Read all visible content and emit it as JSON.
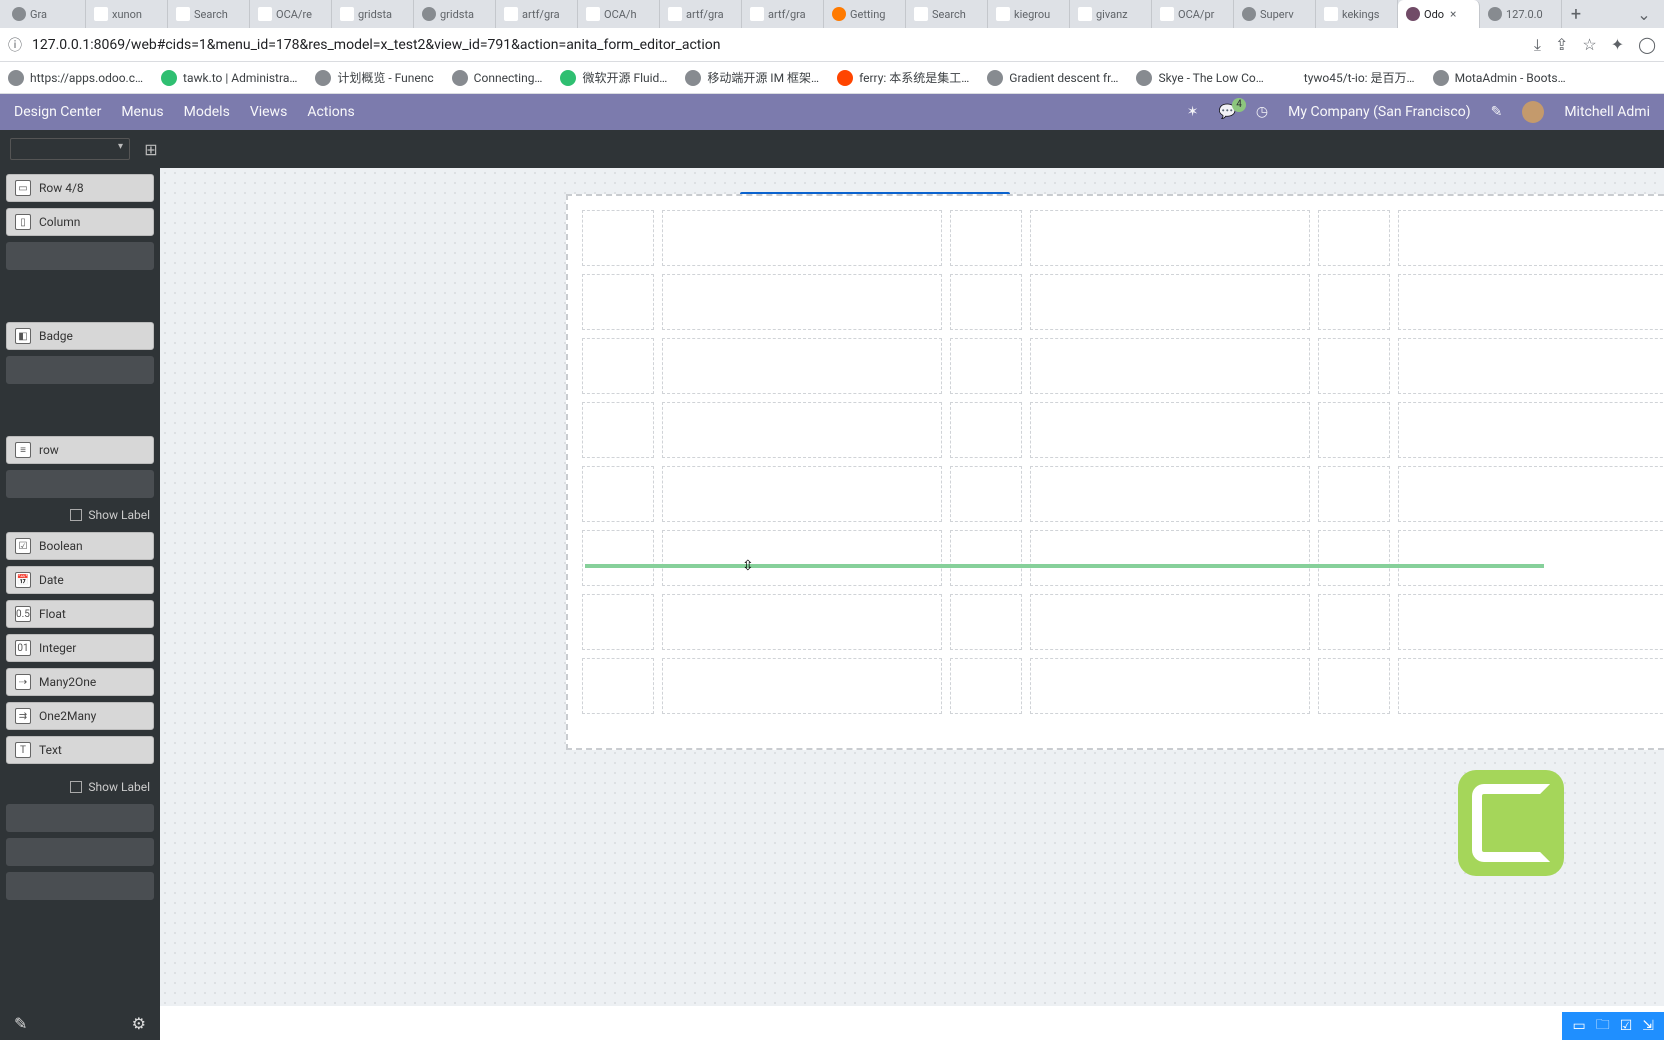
{
  "browser": {
    "tabs": [
      {
        "label": "Gra",
        "fav": "fi-globe"
      },
      {
        "label": "xunon",
        "fav": "fi-github"
      },
      {
        "label": "Search",
        "fav": "fi-github"
      },
      {
        "label": "OCA/re",
        "fav": "fi-github"
      },
      {
        "label": "gridsta",
        "fav": "fi-github"
      },
      {
        "label": "gridsta",
        "fav": "fi-globe"
      },
      {
        "label": "artf/gra",
        "fav": "fi-github"
      },
      {
        "label": "OCA/h",
        "fav": "fi-github"
      },
      {
        "label": "artf/gra",
        "fav": "fi-github"
      },
      {
        "label": "artf/gra",
        "fav": "fi-github"
      },
      {
        "label": "Getting",
        "fav": "fi-orange"
      },
      {
        "label": "Search",
        "fav": "fi-github"
      },
      {
        "label": "kiegrou",
        "fav": "fi-github"
      },
      {
        "label": "givanz",
        "fav": "fi-github"
      },
      {
        "label": "OCA/pr",
        "fav": "fi-github"
      },
      {
        "label": "Superv",
        "fav": "fi-globe"
      },
      {
        "label": "kekings",
        "fav": "fi-github"
      },
      {
        "label": "Odo",
        "fav": "fi-odoo",
        "active": true
      },
      {
        "label": "127.0.0",
        "fav": "fi-globe"
      }
    ],
    "url": "127.0.0.1:8069/web#cids=1&menu_id=178&res_model=x_test2&view_id=791&action=anita_form_editor_action",
    "bookmarks": [
      {
        "label": "https://apps.odoo.c…",
        "fav": "fi-globe"
      },
      {
        "label": "tawk.to | Administra…",
        "fav": "fi-green"
      },
      {
        "label": "计划概览 - Funenc",
        "fav": "fi-globe"
      },
      {
        "label": "Connecting…",
        "fav": "fi-globe"
      },
      {
        "label": "微软开源 Fluid…",
        "fav": "fi-green"
      },
      {
        "label": "移动端开源 IM 框架…",
        "fav": "fi-globe"
      },
      {
        "label": "ferry: 本系统是集工…",
        "fav": "fi-reddit"
      },
      {
        "label": "Gradient descent fr…",
        "fav": "fi-globe"
      },
      {
        "label": "Skye - The Low Co…",
        "fav": "fi-globe"
      },
      {
        "label": "tywo45/t-io: 是百万…",
        "fav": "fi-github"
      },
      {
        "label": "MotaAdmin - Boots…",
        "fav": "fi-globe"
      }
    ]
  },
  "odoo_nav": {
    "items": [
      "Design Center",
      "Menus",
      "Models",
      "Views",
      "Actions"
    ],
    "msg_count": "4",
    "company": "My Company (San Francisco)",
    "user": "Mitchell Admi"
  },
  "palette": {
    "structure": [
      {
        "label": "Row 4/8"
      },
      {
        "label": "Column"
      }
    ],
    "misc": [
      {
        "label": "Badge"
      }
    ],
    "layout": [
      {
        "label": "row"
      }
    ],
    "show_label_1": "Show Label",
    "fields": [
      {
        "label": "Boolean"
      },
      {
        "label": "Date"
      },
      {
        "label": "Float"
      },
      {
        "label": "Integer"
      },
      {
        "label": "Many2One"
      },
      {
        "label": "One2Many"
      },
      {
        "label": "Text"
      }
    ],
    "show_label_2": "Show Label"
  }
}
